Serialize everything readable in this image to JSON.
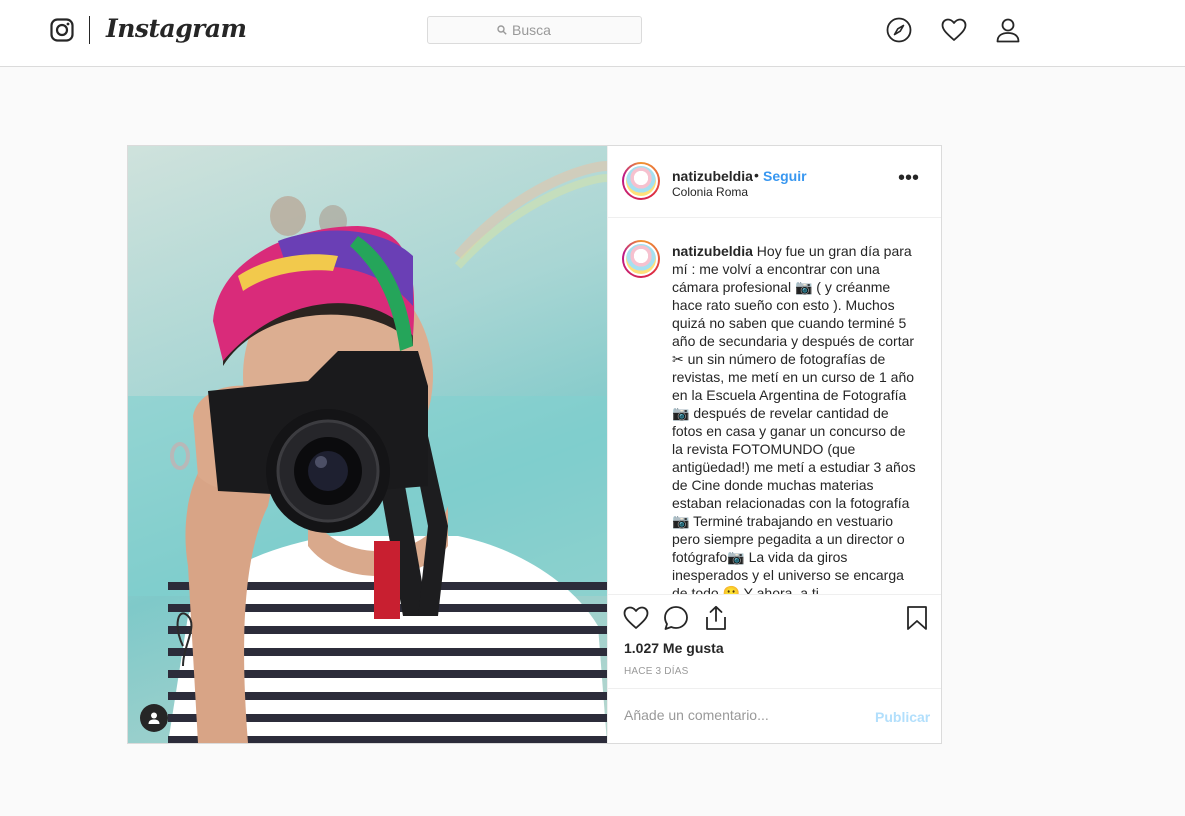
{
  "topbar": {
    "logo_text": "Instagram",
    "search_placeholder": "Busca",
    "icons": [
      "explore-compass-icon",
      "activity-heart-icon",
      "profile-user-icon"
    ]
  },
  "post": {
    "header": {
      "username": "natizubeldia",
      "separator": "•",
      "follow_label": "Seguir",
      "location": "Colonia Roma",
      "more_label": "•••"
    },
    "caption": {
      "username": "natizubeldia",
      "text": "Hoy fue un gran día para mí : me volví a encontrar con una cámara profesional 📷 ( y créanme hace rato sueño con esto ). Muchos quizá no saben que cuando terminé 5 año de secundaria y después de cortar ✂ un sin número de fotografías de revistas, me metí en un curso de 1 año en la Escuela Argentina de Fotografía 📷 después de revelar cantidad de fotos en casa y ganar un concurso de la revista FOTOMUNDO (que antigüedad!) me metí a estudiar 3 años de Cine donde muchas materias estaban relacionadas con la fotografía 📷 Terminé trabajando en vestuario pero siempre pegadita a un director o fotógrafo📷 La vida da giros inesperados y el universo se encarga de todo 🙂 Y ahora, a ti..."
    },
    "likes": "1.027 Me gusta",
    "time_ago": "HACE 3 DÍAS",
    "comment_placeholder": "Añade un comentario...",
    "publish_label": "Publicar"
  },
  "colors": {
    "link_blue": "#3897f0",
    "publish_disabled": "#b2dffc",
    "border": "#dbdbdb",
    "background": "#fafafa"
  }
}
